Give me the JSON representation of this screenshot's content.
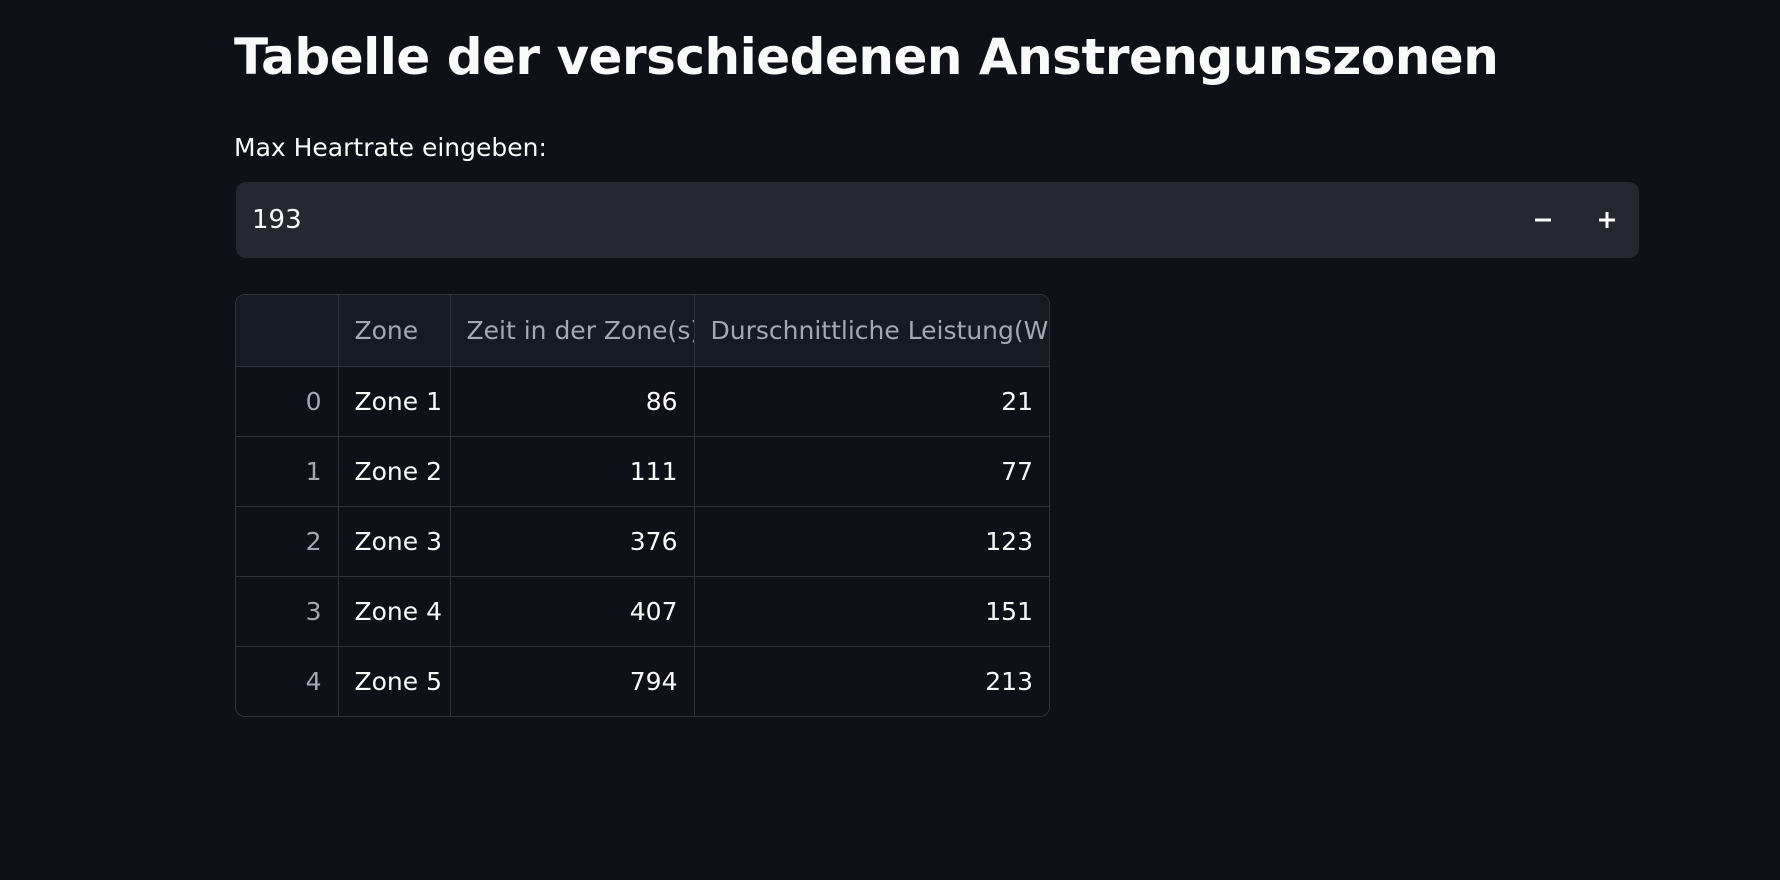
{
  "header": {
    "title": "Tabelle der verschiedenen Anstrengunszonen"
  },
  "heartrate_input": {
    "label": "Max Heartrate eingeben:",
    "value": "193",
    "decrement_icon": "minus-icon",
    "increment_icon": "plus-icon"
  },
  "zones_table": {
    "columns": [
      "",
      "Zone",
      "Zeit in der Zone(s)",
      "Durschnittliche Leistung(W)"
    ],
    "rows": [
      {
        "index": "0",
        "zone": "Zone 1",
        "time": "86",
        "power": "21"
      },
      {
        "index": "1",
        "zone": "Zone 2",
        "time": "111",
        "power": "77"
      },
      {
        "index": "2",
        "zone": "Zone 3",
        "time": "376",
        "power": "123"
      },
      {
        "index": "3",
        "zone": "Zone 4",
        "time": "407",
        "power": "151"
      },
      {
        "index": "4",
        "zone": "Zone 5",
        "time": "794",
        "power": "213"
      }
    ]
  },
  "colors": {
    "background": "#0e1117",
    "input_background": "#262730",
    "text": "#fafafa",
    "muted_text": "#a3a8b4",
    "border": "#31333f"
  }
}
